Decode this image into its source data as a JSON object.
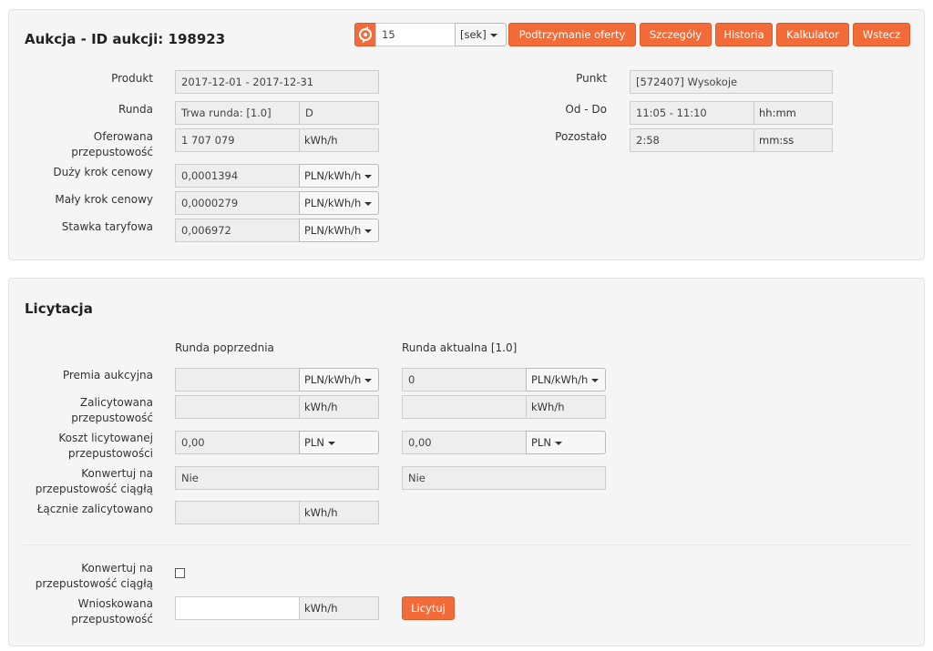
{
  "header": {
    "title": "Aukcja - ID aukcji: 198923",
    "refresh_value": "15",
    "refresh_unit": "[sek]",
    "buttons": {
      "podtrzymanie": "Podtrzymanie oferty",
      "szczegoly": "Szczegóły",
      "historia": "Historia",
      "kalkulator": "Kalkulator",
      "wstecz": "Wstecz"
    }
  },
  "auction": {
    "produkt_label": "Produkt",
    "produkt_value": "2017-12-01 - 2017-12-31",
    "runda_label": "Runda",
    "runda_value": "Trwa runda: [1.0]",
    "runda_code": "D",
    "oferowana_label_1": "Oferowana",
    "oferowana_label_2": "przepustowość",
    "oferowana_value": "1 707 079",
    "oferowana_unit": "kWh/h",
    "duzy_krok_label": "Duży krok cenowy",
    "duzy_krok_value": "0,0001394",
    "duzy_krok_unit": "PLN/kWh/h",
    "maly_krok_label": "Mały krok cenowy",
    "maly_krok_value": "0,0000279",
    "maly_krok_unit": "PLN/kWh/h",
    "stawka_label": "Stawka taryfowa",
    "stawka_value": "0,006972",
    "stawka_unit": "PLN/kWh/h",
    "punkt_label": "Punkt",
    "punkt_value": "[572407] Wysokoje",
    "oddo_label": "Od - Do",
    "oddo_value": "11:05 - 11:10",
    "oddo_unit": "hh:mm",
    "pozostalo_label": "Pozostało",
    "pozostalo_value": "2:58",
    "pozostalo_unit": "mm:ss"
  },
  "bidding": {
    "title": "Licytacja",
    "col_prev": "Runda poprzednia",
    "col_curr": "Runda aktualna [1.0]",
    "premia_label": "Premia aukcyjna",
    "premia_prev_value": "",
    "premia_curr_value": "0",
    "premia_unit": "PLN/kWh/h",
    "zalicytowana_label_1": "Zalicytowana",
    "zalicytowana_label_2": "przepustowość",
    "zalicytowana_prev_value": "",
    "zalicytowana_curr_value": "",
    "zalicytowana_unit": "kWh/h",
    "koszt_label_1": "Koszt licytowanej",
    "koszt_label_2": "przepustowości",
    "koszt_prev_value": "0,00",
    "koszt_curr_value": "0,00",
    "koszt_unit": "PLN",
    "konwertuj_label_1": "Konwertuj na",
    "konwertuj_label_2": "przepustowość ciągłą",
    "konwertuj_prev_value": "Nie",
    "konwertuj_curr_value": "Nie",
    "lacznie_label": "Łącznie zalicytowano",
    "lacznie_value": "",
    "lacznie_unit": "kWh/h",
    "form": {
      "konwertuj_label_1": "Konwertuj na",
      "konwertuj_label_2": "przepustowość ciągłą",
      "konwertuj_checked": false,
      "wnioskowana_label_1": "Wnioskowana",
      "wnioskowana_label_2": "przepustowość",
      "wnioskowana_value": "",
      "wnioskowana_unit": "kWh/h",
      "submit_label": "Licytuj"
    }
  },
  "colors": {
    "accent": "#f26b38",
    "panel_bg": "#f5f5f5",
    "field_bg": "#eeeeee"
  }
}
